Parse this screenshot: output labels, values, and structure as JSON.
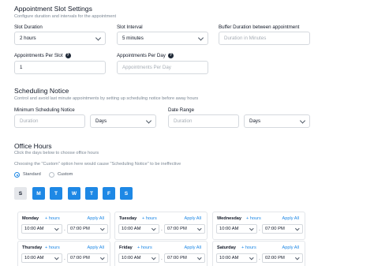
{
  "slot_settings": {
    "title": "Appointment Slot Settings",
    "subtitle": "Configure duration and intervals for the appointment",
    "slot_duration": {
      "label": "Slot Duration",
      "value": "2 hours"
    },
    "slot_interval": {
      "label": "Slot Interval",
      "value": "5 minutes"
    },
    "buffer_duration": {
      "label": "Buffer Duration between appointment",
      "placeholder": "Duration in Minutes"
    },
    "appointments_per_slot": {
      "label": "Appointments Per Slot",
      "value": "1"
    },
    "appointments_per_day": {
      "label": "Appointments Per Day",
      "placeholder": "Appointments Per Day"
    }
  },
  "scheduling_notice": {
    "title": "Scheduling Notice",
    "subtitle": "Control and avoid last minute appointments by setting up scheduling notice before away hours",
    "minimum": {
      "label": "Minimum Scheduling Notice",
      "placeholder": "Duration",
      "unit": "Days"
    },
    "date_range": {
      "label": "Date Range",
      "placeholder": "Duration",
      "unit": "Days"
    }
  },
  "office_hours": {
    "title": "Office Hours",
    "subtitle": "Click the days below to choose office hours",
    "note": "Choosing the \"Custom\" option here would cause \"Scheduling Notice\" to be ineffective",
    "mode_options": [
      "Standard",
      "Custom"
    ],
    "selected_mode": "Standard",
    "days": [
      {
        "letter": "S",
        "active": false
      },
      {
        "letter": "M",
        "active": true
      },
      {
        "letter": "T",
        "active": true
      },
      {
        "letter": "W",
        "active": true
      },
      {
        "letter": "T",
        "active": true
      },
      {
        "letter": "F",
        "active": true
      },
      {
        "letter": "S",
        "active": true
      }
    ],
    "add_hours_label": "+ hours",
    "apply_all_label": "Apply All",
    "cards": [
      {
        "day": "Monday",
        "start": "10:00 AM",
        "end": "07:00 PM"
      },
      {
        "day": "Tuesday",
        "start": "10:00 AM",
        "end": "07:00 PM"
      },
      {
        "day": "Wednesday",
        "start": "10:00 AM",
        "end": "07:00 PM"
      },
      {
        "day": "Thursday",
        "start": "10:00 AM",
        "end": "07:00 PM"
      },
      {
        "day": "Friday",
        "start": "10:00 AM",
        "end": "07:00 PM"
      },
      {
        "day": "Saturday",
        "start": "10:00 AM",
        "end": "02:00 PM"
      }
    ]
  },
  "colors": {
    "accent": "#1e88e5",
    "inactive_day": "#e5e7eb",
    "border": "#d5d9de",
    "muted_text": "#7b8794"
  }
}
